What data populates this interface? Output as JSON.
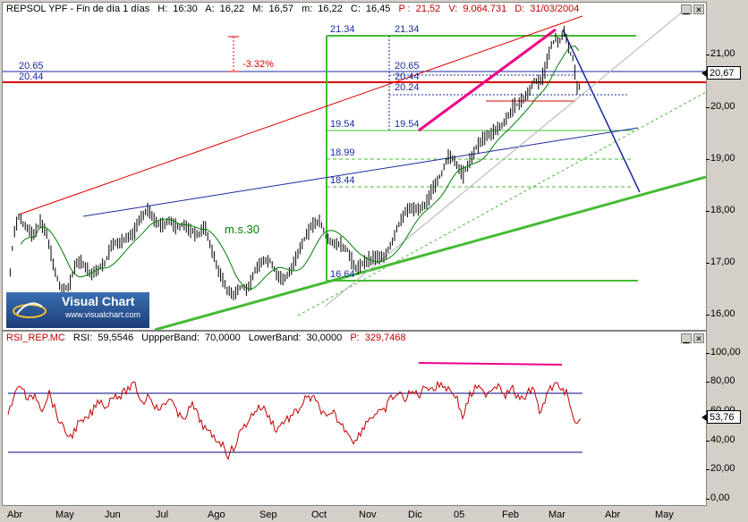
{
  "header": {
    "title": "REPSOL YPF - Fin de día 1 días",
    "h_label": "H:",
    "h": "16:30",
    "a_label": "A:",
    "a": "16,22",
    "m_label": "M:",
    "m": "16,57",
    "mn_label": "m:",
    "mn": "16,22",
    "c_label": "C:",
    "c": "16,45",
    "p_label": "P :",
    "p": "21,52",
    "v_label": "V:",
    "v": "9.064.731",
    "d_label": "D:",
    "d": "31/03/2004"
  },
  "rsi_header": {
    "name": "RSI_REP.MC",
    "rsi_label": "RSI:",
    "rsi": "59,5546",
    "ub_label": "UppperBand:",
    "ub": "70,0000",
    "lb_label": "LowerBand:",
    "lb": "30,0000",
    "p_label": "P:",
    "p": "329,7468"
  },
  "price_axis": [
    "21,00",
    "20,00",
    "19,00",
    "18,00",
    "17,00",
    "16,00"
  ],
  "price_current": "20,67",
  "rsi_axis": [
    "100,00",
    "80,00",
    "60,00",
    "40,00",
    "20,00",
    "0,00"
  ],
  "rsi_current": "53,76",
  "x_labels": [
    "Abr",
    "May",
    "Jun",
    "Jul",
    "Ago",
    "Sep",
    "Oct",
    "Nov",
    "Dic",
    "05",
    "Feb",
    "Mar",
    "Abr",
    "May"
  ],
  "annotations": {
    "pct": "-3.32%",
    "ma": "m.s.30",
    "lvl_2134a": "21.34",
    "lvl_2134b": "21.34",
    "lvl_2065a": "20.65",
    "lvl_2044a": "20.44",
    "lvl_2065b": "20.65",
    "lvl_2044b": "20.44",
    "lvl_2024": "20.24",
    "lvl_1954a": "19.54",
    "lvl_1954b": "19.54",
    "lvl_1899": "18.99",
    "lvl_1844": "18.44",
    "lvl_1664": "16.64"
  },
  "logo": {
    "title": "Visual Chart",
    "url": "www.visualchart.com"
  },
  "colors": {
    "price": "#000000",
    "ma": "#008000",
    "rsi": "#c00000",
    "band": "#000080",
    "green_line": "#44bb33",
    "red_line": "#e00000",
    "magenta": "#ee0088",
    "blue": "#1a2aa0"
  },
  "chart_data": [
    {
      "type": "bar",
      "title": "REPSOL YPF - Fin de día 1 días",
      "x_range": [
        "Abr",
        "May"
      ],
      "ylim": [
        15.7,
        21.7
      ],
      "overlay": "m.s.30"
    },
    {
      "type": "line",
      "title": "RSI_REP.MC",
      "ylim": [
        0,
        100
      ],
      "bands": [
        70,
        30
      ],
      "last": 53.76
    }
  ]
}
